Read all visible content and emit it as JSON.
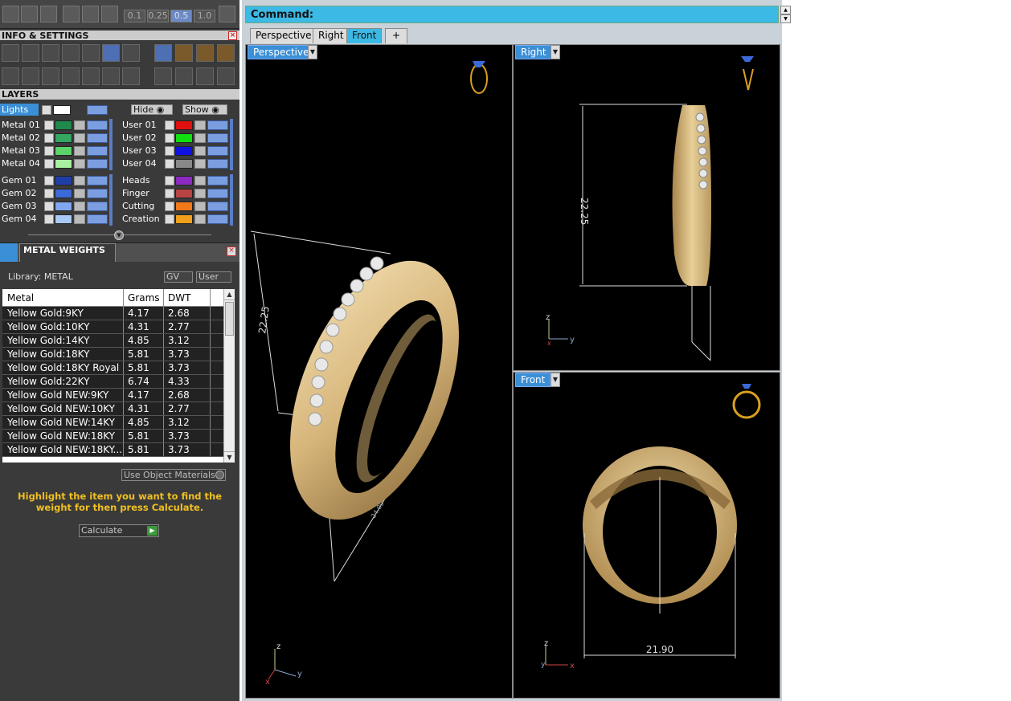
{
  "toolbar": {
    "zooms": [
      "0.1",
      "0.25",
      "0.5",
      "1.0"
    ],
    "selected_zoom": "0.5"
  },
  "info_settings": {
    "title": "INFO & SETTINGS"
  },
  "layers_panel": {
    "title": "LAYERS",
    "lights_label": "Lights",
    "hide_label": "Hide",
    "show_label": "Show",
    "left_groups": [
      [
        {
          "name": "Metal 01",
          "color": "#1f8a4c"
        },
        {
          "name": "Metal 02",
          "color": "#32a860"
        },
        {
          "name": "Metal 03",
          "color": "#5bd46a"
        },
        {
          "name": "Metal 04",
          "color": "#a8f0a0"
        }
      ],
      [
        {
          "name": "Gem 01",
          "color": "#1f3fa8"
        },
        {
          "name": "Gem 02",
          "color": "#3a6ad8"
        },
        {
          "name": "Gem 03",
          "color": "#7fa8f0"
        },
        {
          "name": "Gem 04",
          "color": "#a8c8f8"
        }
      ]
    ],
    "right_groups": [
      [
        {
          "name": "User 01",
          "color": "#e01010"
        },
        {
          "name": "User 02",
          "color": "#10e010"
        },
        {
          "name": "User 03",
          "color": "#1010e0"
        },
        {
          "name": "User 04",
          "color": "#888888"
        }
      ],
      [
        {
          "name": "Heads",
          "color": "#8a2ac0"
        },
        {
          "name": "Finger",
          "color": "#b84444"
        },
        {
          "name": "Cutting",
          "color": "#f07a1a"
        },
        {
          "name": "Creation",
          "color": "#f0a01a"
        }
      ]
    ]
  },
  "metal_weights": {
    "title": "METAL WEIGHTS",
    "library": "Library: METAL",
    "gv_label": "GV",
    "user_label": "User",
    "columns": [
      "Metal",
      "Grams",
      "DWT"
    ],
    "rows": [
      [
        "Yellow Gold:9KY",
        "4.17",
        "2.68"
      ],
      [
        "Yellow Gold:10KY",
        "4.31",
        "2.77"
      ],
      [
        "Yellow Gold:14KY",
        "4.85",
        "3.12"
      ],
      [
        "Yellow Gold:18KY",
        "5.81",
        "3.73"
      ],
      [
        "Yellow Gold:18KY Royal",
        "5.81",
        "3.73"
      ],
      [
        "Yellow Gold:22KY",
        "6.74",
        "4.33"
      ],
      [
        "Yellow Gold NEW:9KY",
        "4.17",
        "2.68"
      ],
      [
        "Yellow Gold NEW:10KY",
        "4.31",
        "2.77"
      ],
      [
        "Yellow Gold NEW:14KY",
        "4.85",
        "3.12"
      ],
      [
        "Yellow Gold NEW:18KY",
        "5.81",
        "3.73"
      ],
      [
        "Yellow Gold NEW:18KY...",
        "5.81",
        "3.73"
      ]
    ],
    "use_object_materials": "Use Object Materials",
    "hint": "Highlight the item you want to find the weight for then press Calculate.",
    "calculate_label": "Calculate"
  },
  "command": {
    "label": "Command:"
  },
  "view_tabs": [
    "Perspective",
    "Right",
    "Front"
  ],
  "active_view_tab": "Front",
  "viewports": {
    "perspective": {
      "label": "Perspective",
      "dimension": "22.25",
      "diag": "24.09"
    },
    "right": {
      "label": "Right",
      "dimension": "22.25"
    },
    "front": {
      "label": "Front",
      "dimension": "21.90"
    }
  },
  "axes": {
    "x": "x",
    "y": "y",
    "z": "z"
  },
  "colors": {
    "accent": "#3cb9e4",
    "gold": "#d8b877",
    "panel_bg": "#3a3a3a"
  }
}
